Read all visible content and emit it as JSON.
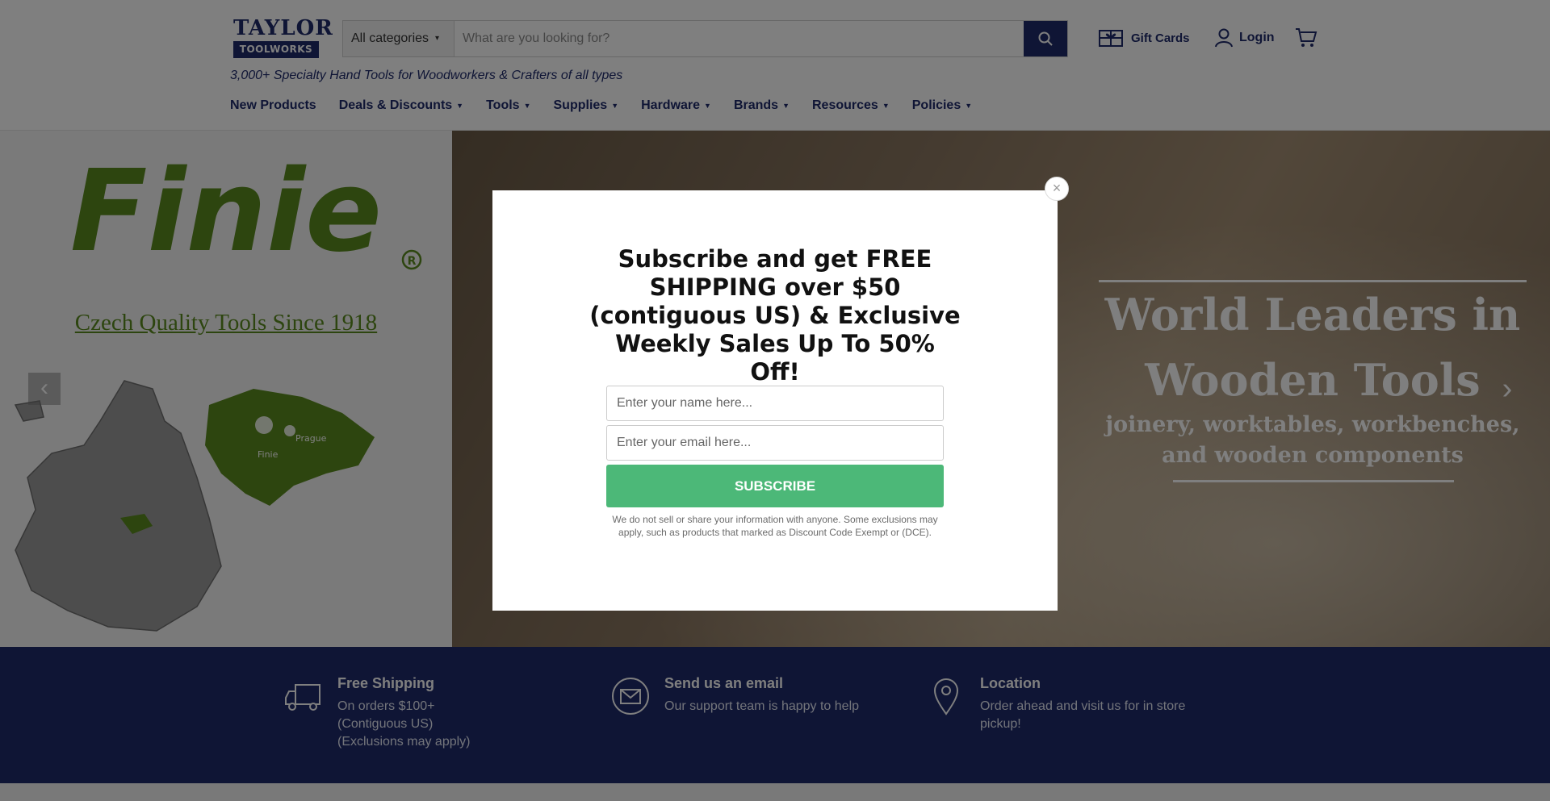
{
  "brand": {
    "logo_top": "TAYLOR",
    "logo_bottom": "TOOLWORKS",
    "tagline": "3,000+ Specialty Hand Tools for Woodworkers & Crafters of all types"
  },
  "search": {
    "category": "All categories",
    "placeholder": "What are you looking for?"
  },
  "header_links": {
    "gift_cards": "Gift Cards",
    "login": "Login"
  },
  "nav": [
    {
      "label": "New Products",
      "has_menu": false
    },
    {
      "label": "Deals & Discounts",
      "has_menu": true
    },
    {
      "label": "Tools",
      "has_menu": true
    },
    {
      "label": "Supplies",
      "has_menu": true
    },
    {
      "label": "Hardware",
      "has_menu": true
    },
    {
      "label": "Brands",
      "has_menu": true
    },
    {
      "label": "Resources",
      "has_menu": true
    },
    {
      "label": "Policies",
      "has_menu": true
    }
  ],
  "hero": {
    "finie_logo": "Finie",
    "finie_subtitle": "Czech Quality Tools Since 1918",
    "map_labels": [
      "Finie",
      "Prague"
    ],
    "title_line1": "World Leaders in",
    "title_line2": "Wooden Tools",
    "subtitle_line1": "joinery, worktables, workbenches,",
    "subtitle_line2": "and wooden components",
    "prev_arrow": "‹",
    "next_arrow": "›"
  },
  "features": [
    {
      "icon": "truck-icon",
      "title": "Free Shipping",
      "lines": [
        "On orders $100+",
        "(Contiguous US)",
        "(Exclusions may apply)"
      ]
    },
    {
      "icon": "mail-icon",
      "title": "Send us an email",
      "lines": [
        "Our support team is happy to help"
      ]
    },
    {
      "icon": "location-pin-icon",
      "title": "Location",
      "lines": [
        "Order ahead and visit us for in store",
        "pickup!"
      ]
    }
  ],
  "modal": {
    "title": "Subscribe and get FREE SHIPPING over $50 (contiguous US) & Exclusive Weekly Sales Up To 50% Off!",
    "name_placeholder": "Enter your name here...",
    "email_placeholder": "Enter your email here...",
    "subscribe_label": "SUBSCRIBE",
    "note": "We do not sell or share your information with anyone. Some exclusions may apply, such as products that marked as Discount Code Exempt or (DCE).",
    "close": "×"
  },
  "colors": {
    "navy": "#1f2a6b",
    "finie_green": "#5a8a1f",
    "subscribe_green": "#4cb878"
  }
}
